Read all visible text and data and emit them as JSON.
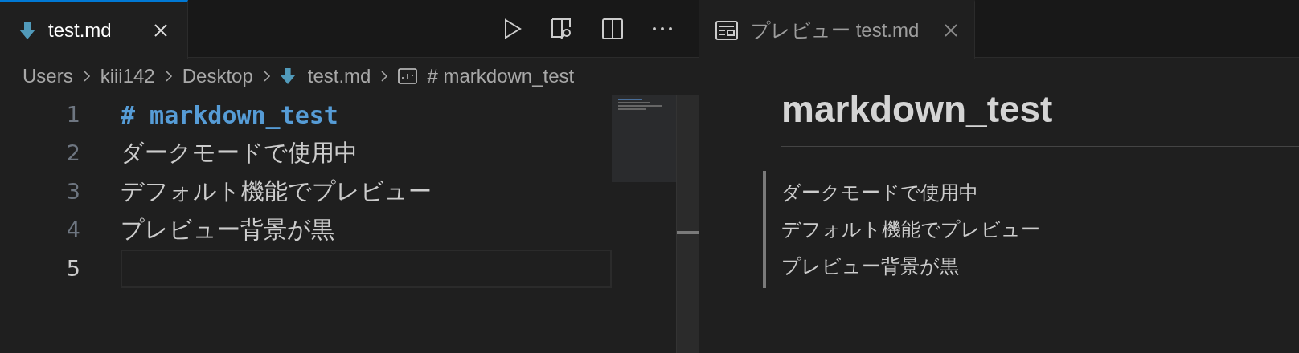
{
  "editor": {
    "tab": {
      "label": "test.md",
      "focused": true
    },
    "breadcrumbs": [
      {
        "kind": "folder",
        "label": "Users"
      },
      {
        "kind": "folder",
        "label": "kiii142"
      },
      {
        "kind": "folder",
        "label": "Desktop"
      },
      {
        "kind": "file",
        "label": "test.md"
      },
      {
        "kind": "symbol",
        "label": "# markdown_test"
      }
    ],
    "lines": [
      {
        "number": "1",
        "kind": "heading",
        "text": "# markdown_test",
        "current": false
      },
      {
        "number": "2",
        "kind": "text",
        "text": "ダークモードで使用中",
        "current": false
      },
      {
        "number": "3",
        "kind": "text",
        "text": "デフォルト機能でプレビュー",
        "current": false
      },
      {
        "number": "4",
        "kind": "text",
        "text": "プレビュー背景が黒",
        "current": false
      },
      {
        "number": "5",
        "current": true
      }
    ]
  },
  "preview": {
    "tab": {
      "label": "プレビュー test.md",
      "focused": false
    },
    "heading": "markdown_test",
    "quote_lines": [
      "ダークモードで使用中",
      "デフォルト機能でプレビュー",
      "プレビュー背景が黒"
    ]
  }
}
